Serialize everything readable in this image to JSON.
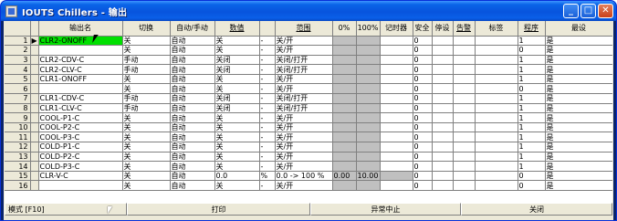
{
  "window": {
    "title": "IOUTS Chillers - 输出",
    "minimize_label": "_",
    "maximize_label": "□",
    "close_label": "✕"
  },
  "grid": {
    "columns": [
      "",
      "",
      "输出名",
      "切换",
      "自动/手动",
      "数值",
      "",
      "范围",
      "0%",
      "100%",
      "记时器",
      "安全",
      "停设",
      "告警",
      "标签",
      "程序",
      "最设"
    ],
    "rows": [
      {
        "num": "1",
        "ptr": "▶",
        "name": "CLR2-ONOFF",
        "switch": "关",
        "mode": "自动",
        "value": "关",
        "unit": "-",
        "range": "关/开",
        "p0": "",
        "p100": "",
        "timer": "",
        "safety": "0",
        "stop": "",
        "alarm": "",
        "tag": "",
        "prog": "1",
        "last": "是"
      },
      {
        "num": "2",
        "ptr": "",
        "name": "",
        "switch": "关",
        "mode": "自动",
        "value": "关",
        "unit": "-",
        "range": "关/开",
        "p0": "",
        "p100": "",
        "timer": "",
        "safety": "0",
        "stop": "",
        "alarm": "",
        "tag": "",
        "prog": "0",
        "last": "是"
      },
      {
        "num": "3",
        "ptr": "",
        "name": "CLR2-CDV-C",
        "switch": "手动",
        "mode": "自动",
        "value": "关闭",
        "unit": "-",
        "range": "关闭/打开",
        "p0": "",
        "p100": "",
        "timer": "",
        "safety": "0",
        "stop": "",
        "alarm": "",
        "tag": "",
        "prog": "1",
        "last": "是"
      },
      {
        "num": "4",
        "ptr": "",
        "name": "CLR2-CLV-C",
        "switch": "手动",
        "mode": "自动",
        "value": "关闭",
        "unit": "-",
        "range": "关闭/打开",
        "p0": "",
        "p100": "",
        "timer": "",
        "safety": "0",
        "stop": "",
        "alarm": "",
        "tag": "",
        "prog": "1",
        "last": "是"
      },
      {
        "num": "5",
        "ptr": "",
        "name": "CLR1-ONOFF",
        "switch": "关",
        "mode": "自动",
        "value": "关",
        "unit": "-",
        "range": "关/开",
        "p0": "",
        "p100": "",
        "timer": "",
        "safety": "0",
        "stop": "",
        "alarm": "",
        "tag": "",
        "prog": "1",
        "last": "是"
      },
      {
        "num": "6",
        "ptr": "",
        "name": "",
        "switch": "关",
        "mode": "自动",
        "value": "关",
        "unit": "-",
        "range": "关/开",
        "p0": "",
        "p100": "",
        "timer": "",
        "safety": "0",
        "stop": "",
        "alarm": "",
        "tag": "",
        "prog": "0",
        "last": "是"
      },
      {
        "num": "7",
        "ptr": "",
        "name": "CLR1-CDV-C",
        "switch": "手动",
        "mode": "自动",
        "value": "关闭",
        "unit": "-",
        "range": "关闭/打开",
        "p0": "",
        "p100": "",
        "timer": "",
        "safety": "0",
        "stop": "",
        "alarm": "",
        "tag": "",
        "prog": "1",
        "last": "是"
      },
      {
        "num": "8",
        "ptr": "",
        "name": "CLR1-CLV-C",
        "switch": "手动",
        "mode": "自动",
        "value": "关闭",
        "unit": "-",
        "range": "关闭/打开",
        "p0": "",
        "p100": "",
        "timer": "",
        "safety": "0",
        "stop": "",
        "alarm": "",
        "tag": "",
        "prog": "1",
        "last": "是"
      },
      {
        "num": "9",
        "ptr": "",
        "name": "COOL-P1-C",
        "switch": "关",
        "mode": "自动",
        "value": "关",
        "unit": "-",
        "range": "关/开",
        "p0": "",
        "p100": "",
        "timer": "",
        "safety": "0",
        "stop": "",
        "alarm": "",
        "tag": "",
        "prog": "1",
        "last": "是"
      },
      {
        "num": "10",
        "ptr": "",
        "name": "COOL-P2-C",
        "switch": "关",
        "mode": "自动",
        "value": "关",
        "unit": "-",
        "range": "关/开",
        "p0": "",
        "p100": "",
        "timer": "",
        "safety": "0",
        "stop": "",
        "alarm": "",
        "tag": "",
        "prog": "1",
        "last": "是"
      },
      {
        "num": "11",
        "ptr": "",
        "name": "COOL-P3-C",
        "switch": "关",
        "mode": "自动",
        "value": "关",
        "unit": "-",
        "range": "关/开",
        "p0": "",
        "p100": "",
        "timer": "",
        "safety": "0",
        "stop": "",
        "alarm": "",
        "tag": "",
        "prog": "1",
        "last": "是"
      },
      {
        "num": "12",
        "ptr": "",
        "name": "COLD-P1-C",
        "switch": "关",
        "mode": "自动",
        "value": "关",
        "unit": "-",
        "range": "关/开",
        "p0": "",
        "p100": "",
        "timer": "",
        "safety": "0",
        "stop": "",
        "alarm": "",
        "tag": "",
        "prog": "1",
        "last": "是"
      },
      {
        "num": "13",
        "ptr": "",
        "name": "COLD-P2-C",
        "switch": "关",
        "mode": "自动",
        "value": "关",
        "unit": "-",
        "range": "关/开",
        "p0": "",
        "p100": "",
        "timer": "",
        "safety": "0",
        "stop": "",
        "alarm": "",
        "tag": "",
        "prog": "1",
        "last": "是"
      },
      {
        "num": "14",
        "ptr": "",
        "name": "COLD-P3-C",
        "switch": "关",
        "mode": "自动",
        "value": "关",
        "unit": "-",
        "range": "关/开",
        "p0": "",
        "p100": "",
        "timer": "",
        "safety": "0",
        "stop": "",
        "alarm": "",
        "tag": "",
        "prog": "1",
        "last": "是"
      },
      {
        "num": "15",
        "ptr": "",
        "name": "CLR-V-C",
        "switch": "关",
        "mode": "自动",
        "value": "0.0",
        "unit": "%",
        "range": "0.0 -> 100 %",
        "p0": "0.00",
        "p100": "10.00",
        "timer": "",
        "safety": "0",
        "stop": "",
        "alarm": "",
        "tag": "",
        "prog": "0",
        "last": "是"
      },
      {
        "num": "16",
        "ptr": "",
        "name": "",
        "switch": "关",
        "mode": "自动",
        "value": "关",
        "unit": "-",
        "range": "关/开",
        "p0": "",
        "p100": "",
        "timer": "",
        "safety": "0",
        "stop": "",
        "alarm": "",
        "tag": "",
        "prog": "0",
        "last": "是"
      }
    ]
  },
  "statusbar": {
    "mode_label": "模式 [F10]",
    "print_label": "打印",
    "abort_label": "异常中止",
    "close_label": "关闭"
  },
  "colors": {
    "selected_cell": "#00e000",
    "title_bar": "#0a5fe8",
    "client_bg": "#ece9d8"
  }
}
